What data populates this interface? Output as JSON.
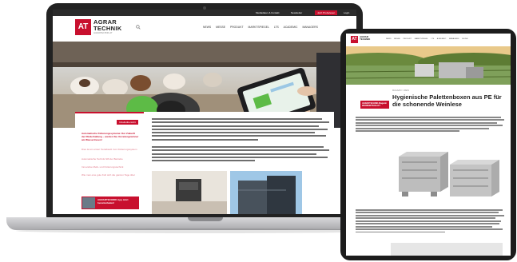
{
  "laptop": {
    "topbar": {
      "item1": "Mediadaten & Kontakt",
      "item2": "Newsletter",
      "button": "Jetzt Probelesen",
      "login": "Login"
    },
    "logo": {
      "mark": "AT",
      "line1": "AGRAR",
      "line2": "TECHNIK",
      "tagline": "AGRARTECHNIK.AT"
    },
    "nav": [
      "NEWS",
      "MESSE",
      "PRODUKT",
      "MARKTSPIEGEL",
      "LTS",
      "ACADEMIC",
      "MANAGERS",
      "SUCHE"
    ],
    "sidebar": {
      "badge": "Inhaltsübersicht",
      "links": [
        "Automatische Fütterungssysteme: Der Zukunft der Rinderhaltung – werden Sie Vorreitergewinner am Wassertresen!",
        "Dies ist ein erster Textabsatz zum Fütterungssystem",
        "Automatische Technik hilft der Betriebe",
        "Innovative Melk- und Fütterungstechnik",
        "Wie man eine gute Kuh sich die ganzen Tage über"
      ],
      "banner": "AGRARTECHNIK App Jetzt herunterladen!"
    }
  },
  "tablet": {
    "logo": {
      "mark": "AT",
      "line1": "AGRAR",
      "line2": "TECHNIK"
    },
    "nav": [
      "NEWS",
      "MESSE",
      "PRODUKT",
      "MARKTSPIEGEL",
      "LTS",
      "ACADEMIC",
      "MANAGERS",
      "SUCHE"
    ],
    "breadcrumb": "MAGAZIN > WEIN",
    "badge": "AGRARTECHNIK-Magazin WEINWIRTSCHAFT",
    "title": "Hygienische Palettenboxen aus PE für die schonende Weinlese"
  },
  "colors": {
    "brand_red": "#c8102e",
    "dark": "#222222"
  }
}
